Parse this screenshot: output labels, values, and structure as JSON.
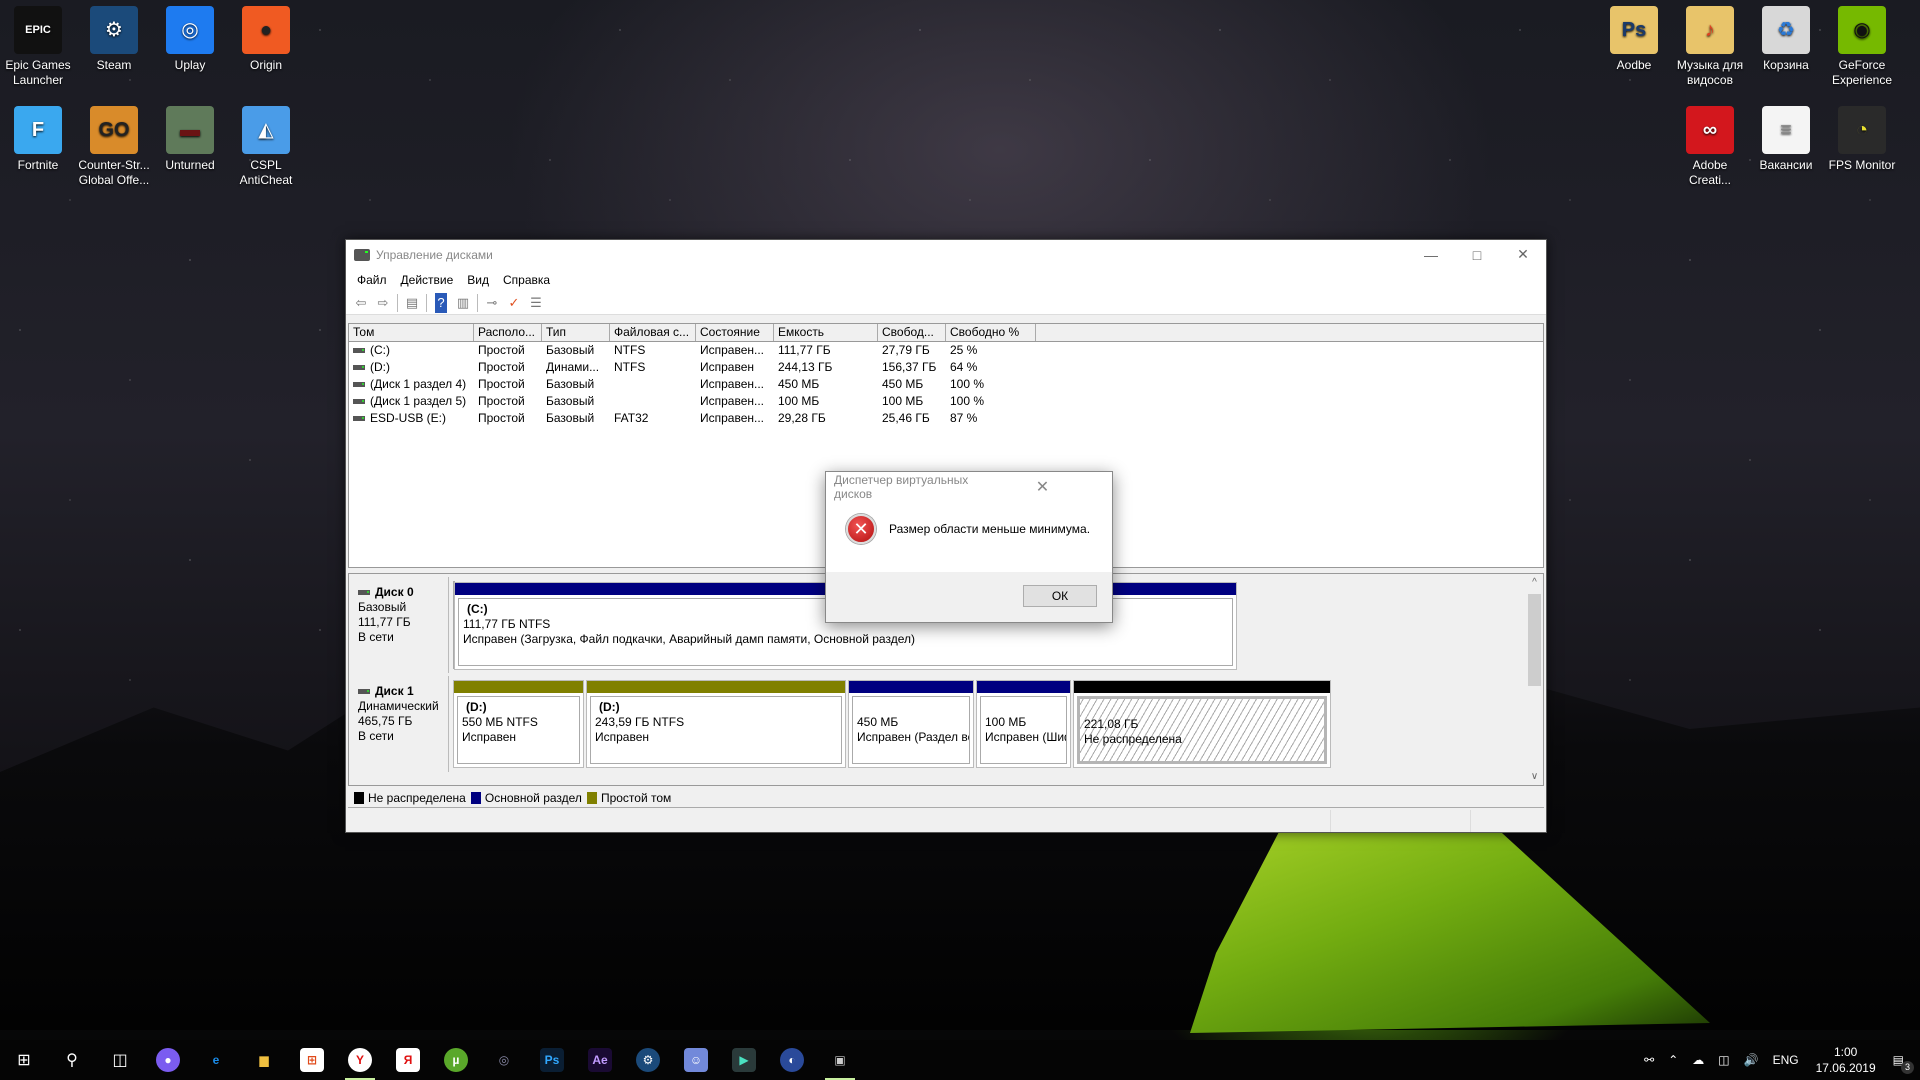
{
  "desktop": {
    "left_icons": [
      {
        "label": "Epic Games Launcher",
        "icon": "epic-games-icon",
        "glyph": "EPIC",
        "bg": "#111111",
        "fg": "#ffffff",
        "shortcut": true
      },
      {
        "label": "Steam",
        "icon": "steam-icon",
        "glyph": "⚙",
        "bg": "#1b4a7a",
        "fg": "#ffffff",
        "shortcut": true
      },
      {
        "label": "Uplay",
        "icon": "uplay-icon",
        "glyph": "◎",
        "bg": "#1e7bf0",
        "fg": "#ffffff",
        "shortcut": true
      },
      {
        "label": "Origin",
        "icon": "origin-icon",
        "glyph": "●",
        "bg": "#f05a22",
        "fg": "#222222",
        "shortcut": true
      },
      {
        "label": "Fortnite",
        "icon": "fortnite-icon",
        "glyph": "F",
        "bg": "#3aa8ef",
        "fg": "#ffffff",
        "shortcut": true
      },
      {
        "label": "Counter-Str... Global Offe...",
        "icon": "csgo-icon",
        "glyph": "GO",
        "bg": "#d98b2a",
        "fg": "#222222",
        "shortcut": true
      },
      {
        "label": "Unturned",
        "icon": "unturned-icon",
        "glyph": "▬",
        "bg": "#5f7a5a",
        "fg": "#6a1414",
        "shortcut": true
      },
      {
        "label": "CSPL AntiCheat",
        "icon": "cspl-anticheat-icon",
        "glyph": "◭",
        "bg": "#4a9ce8",
        "fg": "#ffffff",
        "shortcut": true
      }
    ],
    "right_icons": [
      {
        "label": "Aodbe",
        "icon": "folder-icon",
        "glyph": "Ps",
        "bg": "#e8c46a",
        "fg": "#1a3a6a",
        "shortcut": false
      },
      {
        "label": "Музыка для видосов",
        "icon": "music-folder-icon",
        "glyph": "♪",
        "bg": "#e8c46a",
        "fg": "#e04020",
        "shortcut": false
      },
      {
        "label": "Корзина",
        "icon": "recycle-bin-icon",
        "glyph": "♻",
        "bg": "#d8d8d8",
        "fg": "#2a7ad8",
        "shortcut": false
      },
      {
        "label": "GeForce Experience",
        "icon": "geforce-icon",
        "glyph": "◉",
        "bg": "#76b900",
        "fg": "#111111",
        "shortcut": true
      },
      {
        "label": "Adobe Creati...",
        "icon": "adobe-cc-icon",
        "glyph": "∞",
        "bg": "#d3171d",
        "fg": "#ffffff",
        "shortcut": true
      },
      {
        "label": "Вакансии",
        "icon": "text-document-icon",
        "glyph": "≡",
        "bg": "#f4f4f4",
        "fg": "#888888",
        "shortcut": false
      },
      {
        "label": "FPS Monitor",
        "icon": "fps-monitor-icon",
        "glyph": "◔",
        "bg": "#2a2a2a",
        "fg": "#e8e030",
        "shortcut": true
      }
    ]
  },
  "window": {
    "title": "Управление дисками",
    "menu": [
      "Файл",
      "Действие",
      "Вид",
      "Справка"
    ],
    "toolbar": [
      {
        "name": "back-icon",
        "glyph": "⇦"
      },
      {
        "name": "forward-icon",
        "glyph": "⇨"
      },
      {
        "sep": true
      },
      {
        "name": "show-hide-console-tree-icon",
        "glyph": "▤"
      },
      {
        "sep": true
      },
      {
        "name": "help-icon",
        "glyph": "?"
      },
      {
        "name": "show-action-pane-icon",
        "glyph": "▥"
      },
      {
        "sep": true
      },
      {
        "name": "connect-disk-icon",
        "glyph": "⊸"
      },
      {
        "name": "properties-icon",
        "glyph": "✓"
      },
      {
        "name": "view-icon",
        "glyph": "☰"
      }
    ],
    "columns": [
      "Том",
      "Располо...",
      "Тип",
      "Файловая с...",
      "Состояние",
      "Емкость",
      "Свобод...",
      "Свободно %"
    ],
    "volumes": [
      [
        "(C:)",
        "Простой",
        "Базовый",
        "NTFS",
        "Исправен...",
        "111,77 ГБ",
        "27,79 ГБ",
        "25 %"
      ],
      [
        "(D:)",
        "Простой",
        "Динами...",
        "NTFS",
        "Исправен",
        "244,13 ГБ",
        "156,37 ГБ",
        "64 %"
      ],
      [
        "(Диск 1 раздел 4)",
        "Простой",
        "Базовый",
        "",
        "Исправен...",
        "450 МБ",
        "450 МБ",
        "100 %"
      ],
      [
        "(Диск 1 раздел 5)",
        "Простой",
        "Базовый",
        "",
        "Исправен...",
        "100 МБ",
        "100 МБ",
        "100 %"
      ],
      [
        "ESD-USB (E:)",
        "Простой",
        "Базовый",
        "FAT32",
        "Исправен...",
        "29,28 ГБ",
        "25,46 ГБ",
        "87 %"
      ]
    ],
    "disks": [
      {
        "name": "Диск 0",
        "type": "Базовый",
        "size": "111,77 ГБ",
        "status": "В сети",
        "partitions": [
          {
            "title": "(C:)",
            "line1": "111,77 ГБ NTFS",
            "line2": "Исправен (Загрузка, Файл подкачки, Аварийный дамп памяти, Основной раздел)",
            "kind": "primary"
          }
        ]
      },
      {
        "name": "Диск 1",
        "type": "Динамический",
        "size": "465,75 ГБ",
        "status": "В сети",
        "partitions": [
          {
            "title": "(D:)",
            "line1": "550 МБ NTFS",
            "line2": "Исправен",
            "kind": "simple"
          },
          {
            "title": "(D:)",
            "line1": "243,59 ГБ NTFS",
            "line2": "Исправен",
            "kind": "simple"
          },
          {
            "title": "",
            "line1": "450 МБ",
            "line2": "Исправен (Раздел восстан",
            "kind": "primary"
          },
          {
            "title": "",
            "line1": "100 МБ",
            "line2": "Исправен (Шифро",
            "kind": "primary"
          },
          {
            "title": "",
            "line1": "221,08 ГБ",
            "line2": "Не распределена",
            "kind": "unallocated"
          }
        ]
      }
    ],
    "legend": [
      {
        "label": "Не распределена",
        "kind": "unallocated"
      },
      {
        "label": "Основной раздел",
        "kind": "primary"
      },
      {
        "label": "Простой том",
        "kind": "simple"
      }
    ],
    "colors": {
      "unallocated": "#000000",
      "primary": "#000080",
      "simple": "#808000"
    }
  },
  "dialog": {
    "title": "Диспетчер виртуальных дисков",
    "message": "Размер области меньше минимума.",
    "ok_label": "ОК",
    "close_glyph": "✕",
    "error_glyph": "✕"
  },
  "taskbar": {
    "apps": [
      {
        "name": "alice-icon",
        "glyph": "●",
        "bg": "#7b5cf0",
        "fg": "#ffffff"
      },
      {
        "name": "edge-icon",
        "glyph": "e",
        "bg": "transparent",
        "fg": "#1a8be8"
      },
      {
        "name": "file-explorer-icon",
        "glyph": "▆",
        "bg": "transparent",
        "fg": "#f0c040"
      },
      {
        "name": "store-icon",
        "glyph": "⊞",
        "bg": "#ffffff",
        "fg": "#e04a1a"
      },
      {
        "name": "yandex-browser-icon",
        "glyph": "Y",
        "bg": "#ffffff",
        "fg": "#e01010",
        "active": true
      },
      {
        "name": "yandex-icon",
        "glyph": "Я",
        "bg": "#ffffff",
        "fg": "#e01010"
      },
      {
        "name": "utorrent-icon",
        "glyph": "µ",
        "bg": "#5aa82a",
        "fg": "#ffffff"
      },
      {
        "name": "steering-wheel-icon",
        "glyph": "◎",
        "bg": "transparent",
        "fg": "#8a8aa8"
      },
      {
        "name": "photoshop-icon",
        "glyph": "Ps",
        "bg": "#0a1e33",
        "fg": "#31a8ff"
      },
      {
        "name": "after-effects-icon",
        "glyph": "Ae",
        "bg": "#1a0a33",
        "fg": "#c29bff"
      },
      {
        "name": "steam-taskbar-icon",
        "glyph": "⚙",
        "bg": "#1b4a7a",
        "fg": "#ffffff"
      },
      {
        "name": "discord-icon",
        "glyph": "☺",
        "bg": "#7289da",
        "fg": "#ffffff"
      },
      {
        "name": "filmora-icon",
        "glyph": "▶",
        "bg": "#2a3a3a",
        "fg": "#4ae0c0"
      },
      {
        "name": "cinema4d-icon",
        "glyph": "◐",
        "bg": "#2a4a9a",
        "fg": "#ffffff"
      },
      {
        "name": "disk-management-icon",
        "glyph": "▣",
        "bg": "transparent",
        "fg": "#cccccc",
        "active": true
      }
    ],
    "tray": {
      "language": "ENG",
      "time": "1:00",
      "date": "17.06.2019",
      "notifications": "3"
    }
  }
}
